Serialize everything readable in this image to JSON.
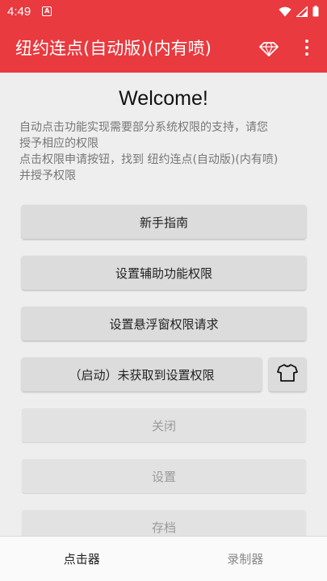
{
  "status_bar": {
    "time": "4:49",
    "notification_glyph": "A"
  },
  "app_bar": {
    "title": "纽约连点(自动版)(内有喷)"
  },
  "main": {
    "welcome": "Welcome!",
    "description_lines": [
      "自动点击功能实现需要部分系统权限的支持，请您",
      "授予相应的权限",
      "点击权限申请按钮，找到 纽约连点(自动版)(内有喷)",
      "并授予权限"
    ],
    "buttons": {
      "guide": "新手指南",
      "accessibility": "设置辅助功能权限",
      "overlay": "设置悬浮窗权限请求",
      "start": "（启动）未获取到设置权限",
      "close": "关闭",
      "settings": "设置",
      "save": "存档"
    }
  },
  "bottom_nav": {
    "tabs": [
      "点击器",
      "录制器"
    ]
  },
  "colors": {
    "accent": "#e93a3f",
    "background": "#eeeeee",
    "button": "#dcdcdc"
  }
}
